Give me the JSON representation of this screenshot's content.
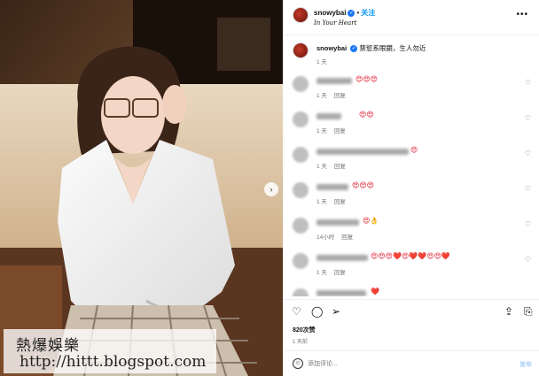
{
  "header": {
    "username": "snowybai",
    "verified_icon": "verified-badge-icon",
    "separator": "•",
    "follow_label": "关注",
    "audio": "In Your Heart",
    "more_icon": "more-options-icon"
  },
  "caption": {
    "username": "snowybai",
    "text": "禁慾系眼鏡，生人勿近",
    "time": "1 天"
  },
  "comments": [
    {
      "text": "😍😍😍",
      "meta": [
        "1 天",
        "回复"
      ]
    },
    {
      "text": "😍😍",
      "meta": [
        "1 天",
        "回复"
      ]
    },
    {
      "text": "😍",
      "meta": [
        "1 天",
        "回复"
      ]
    },
    {
      "text": "😍😍😍",
      "meta": [
        "1 天",
        "回复"
      ]
    },
    {
      "text": "😍👌",
      "meta": [
        "14小时",
        "回复"
      ]
    },
    {
      "text": "😍😍😍❤️😍❤️❤️😍😍❤️",
      "meta": [
        "1 天",
        "回复"
      ]
    },
    {
      "text": "❤️",
      "meta": []
    }
  ],
  "actions": {
    "like_icon": "heart-icon",
    "comment_icon": "comment-icon",
    "share_icon": "share-icon",
    "add_icon": "add-to-story-icon",
    "save_icon": "bookmark-icon"
  },
  "likes": "820次赞",
  "post_time": "1 天前",
  "composer": {
    "placeholder": "添加评论...",
    "post_label": "发布"
  },
  "watermark": {
    "title": "熱爆娛樂",
    "url": "http://hittt.blogspot.com"
  },
  "colors": {
    "accent": "#0095f6",
    "verified": "#1877f2",
    "muted": "#737373"
  }
}
